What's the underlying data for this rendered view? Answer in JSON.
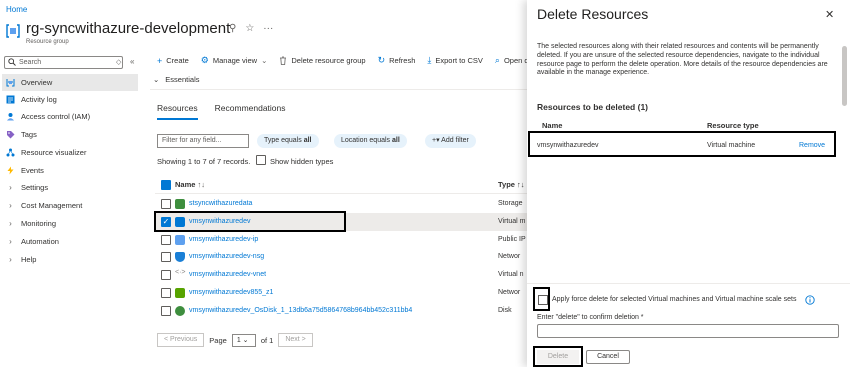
{
  "breadcrumb": "Home",
  "header": {
    "title": "rg-syncwithazure-development",
    "subtitle": "Resource group",
    "pin": "⚲",
    "star": "☆",
    "more": "···"
  },
  "sidebar": {
    "search_placeholder": "Search",
    "collapse": "«",
    "ctrl": "◇",
    "items": [
      {
        "label": "Overview",
        "icon": "overview-icon",
        "chevron": ""
      },
      {
        "label": "Activity log",
        "icon": "activity-log-icon",
        "chevron": ""
      },
      {
        "label": "Access control (IAM)",
        "icon": "iam-icon",
        "chevron": ""
      },
      {
        "label": "Tags",
        "icon": "tag-icon",
        "chevron": ""
      },
      {
        "label": "Resource visualizer",
        "icon": "visualizer-icon",
        "chevron": ""
      },
      {
        "label": "Events",
        "icon": "events-icon",
        "chevron": ""
      },
      {
        "label": "Settings",
        "icon": "",
        "chevron": "›"
      },
      {
        "label": "Cost Management",
        "icon": "",
        "chevron": "›"
      },
      {
        "label": "Monitoring",
        "icon": "",
        "chevron": "›"
      },
      {
        "label": "Automation",
        "icon": "",
        "chevron": "›"
      },
      {
        "label": "Help",
        "icon": "",
        "chevron": "›"
      }
    ]
  },
  "toolbar": {
    "create": "Create",
    "manage_view": "Manage view",
    "delete_rg": "Delete resource group",
    "refresh": "Refresh",
    "export_csv": "Export to CSV",
    "open_query": "Open que"
  },
  "essentials": "Essentials",
  "tabs": [
    "Resources",
    "Recommendations"
  ],
  "filters": {
    "placeholder": "Filter for any field...",
    "type_label": "Type equals",
    "type_value": "all",
    "location_label": "Location equals",
    "location_value": "all",
    "add_filter": "Add filter"
  },
  "showing": "Showing 1 to 7 of 7 records.",
  "show_hidden": "Show hidden types",
  "table": {
    "col_name": "Name",
    "col_name_sort": "↑↓",
    "col_type": "Type ↑↓",
    "rows": [
      {
        "name": "stsyncwithazuredata",
        "type": "Storage",
        "color": "#3e8e3e",
        "selected": false
      },
      {
        "name": "vmsynwithazuredev",
        "type": "Virtual m",
        "color": "#0078d4",
        "selected": true
      },
      {
        "name": "vmsynwithazuredev-ip",
        "type": "Public IP",
        "color": "#5ea0ef",
        "selected": false
      },
      {
        "name": "vmsynwithazuredev-nsg",
        "type": "Networ",
        "color": "#1a7fd6",
        "selected": false
      },
      {
        "name": "vmsynwithazuredev-vnet",
        "type": "Virtual n",
        "color": "#8a8886",
        "selected": false
      },
      {
        "name": "vmsynwithazuredev855_z1",
        "type": "Networ",
        "color": "#57a300",
        "selected": false
      },
      {
        "name": "vmsynwithazuredev_OsDisk_1_13db6a75d5864768b964bb452c311bb4",
        "type": "Disk",
        "color": "#3e8e3e",
        "selected": false
      }
    ]
  },
  "pager": {
    "prev": "< Previous",
    "page_label": "Page",
    "page_value": "1",
    "of_label": "of 1",
    "next": "Next >"
  },
  "panel": {
    "title": "Delete Resources",
    "close": "✕",
    "description": "The selected resources along with their related resources and contents will be permanently deleted. If you are unsure of the selected resource dependencies, navigate to the individual resource page to perform the delete operation. More details of the resource dependencies are available in the manage experience.",
    "to_delete_title": "Resources to be deleted (1)",
    "col_name": "Name",
    "col_type": "Resource type",
    "resource_name": "vmsynwithazuredev",
    "resource_type": "Virtual machine",
    "remove": "Remove",
    "force_label": "Apply force delete for selected Virtual machines and Virtual machine scale sets",
    "confirm_label": "Enter \"delete\" to confirm deletion *",
    "delete_btn": "Delete",
    "cancel_btn": "Cancel"
  }
}
